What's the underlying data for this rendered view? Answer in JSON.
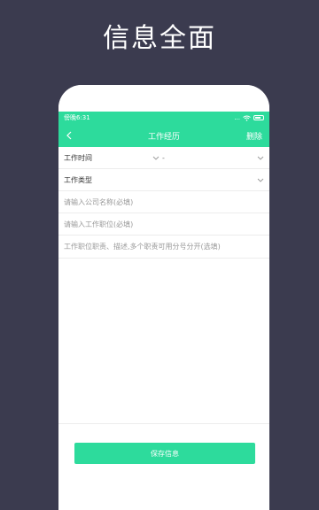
{
  "promo": {
    "title": "信息全面"
  },
  "statusbar": {
    "time": "傍晚6:31",
    "signal": "..."
  },
  "navbar": {
    "title": "工作经历",
    "action": "删除"
  },
  "form": {
    "work_time_label": "工作时间",
    "work_time_separator": "-",
    "work_type_label": "工作类型",
    "company_placeholder": "请输入公司名称(必填)",
    "position_placeholder": "请输入工作职位(必填)",
    "duties_placeholder": "工作职位职责、描述,多个职责可用分号分开(选填)"
  },
  "save_button": {
    "label": "保存信息"
  },
  "colors": {
    "accent": "#2ddb9c",
    "background": "#3b3b4f"
  },
  "icons": [
    "back-icon",
    "chevron-down-icon",
    "wifi-icon",
    "battery-icon"
  ]
}
